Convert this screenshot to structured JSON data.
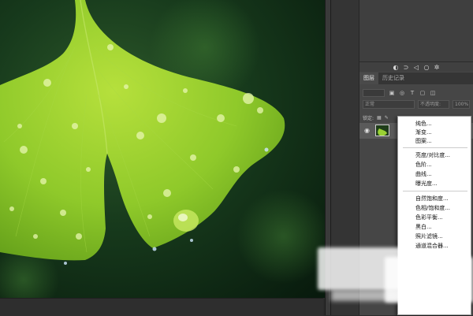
{
  "panel": {
    "tabs": [
      {
        "label": "图层",
        "active": true
      },
      {
        "label": "历史记录",
        "active": false
      }
    ],
    "blend_mode": "正常",
    "opacity_label": "不透明度:",
    "opacity_value": "100%",
    "lock_label": "锁定:",
    "fill_label": "填充:",
    "fill_value": "100%",
    "layer_name": "背景"
  },
  "adjustment_menu": {
    "items": [
      {
        "label": "纯色..."
      },
      {
        "label": "渐变..."
      },
      {
        "label": "图案..."
      },
      {
        "label": "亮度/对比度..."
      },
      {
        "label": "色阶..."
      },
      {
        "label": "曲线..."
      },
      {
        "label": "曝光度..."
      },
      {
        "label": "自然饱和度..."
      },
      {
        "label": "色相/饱和度..."
      },
      {
        "label": "色彩平衡..."
      },
      {
        "label": "黑白..."
      },
      {
        "label": "照片滤镜..."
      },
      {
        "label": "通道混合器..."
      }
    ]
  },
  "colors": {
    "app_background": "#2b2b2b",
    "panel_background": "#464646",
    "selected_layer": "#5a5a5a",
    "leaf_green": "#8fc92a",
    "menu_background": "#ffffff"
  },
  "icons": [
    "eye-icon",
    "link-icon",
    "contrast-icon",
    "adjustment-icon",
    "circle-icon",
    "gear-icon",
    "filter-icon",
    "lock-icon",
    "brush-icon"
  ]
}
